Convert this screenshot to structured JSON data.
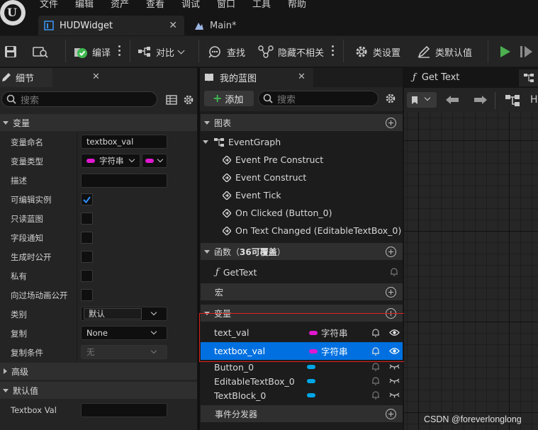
{
  "menu": [
    "文件",
    "编辑",
    "资产",
    "查看",
    "调试",
    "窗口",
    "工具",
    "帮助"
  ],
  "tabs": [
    {
      "label": "HUDWidget",
      "active": true
    },
    {
      "label": "Main*",
      "active": false
    }
  ],
  "toolbar": {
    "compile_label": "编译",
    "diff_label": "对比",
    "find_label": "查找",
    "hide_unrelated_label": "隐藏不相关",
    "class_settings_label": "类设置",
    "class_defaults_label": "类默认值"
  },
  "details": {
    "tab_label": "细节",
    "search_placeholder": "搜索",
    "section_variable": "变量",
    "rows": {
      "var_name_label": "变量命名",
      "var_name_value": "textbox_val",
      "var_type_label": "变量类型",
      "var_type_value": "字符串",
      "description_label": "描述",
      "instance_editable_label": "可编辑实例",
      "readonly_bp_label": "只读蓝图",
      "field_notify_label": "字段通知",
      "expose_on_spawn_label": "生成时公开",
      "private_label": "私有",
      "expose_cinematics_label": "向过场动画公开",
      "category_label": "类别",
      "category_value": "默认",
      "replication_label": "复制",
      "replication_value": "None",
      "replication_condition_label": "复制条件",
      "replication_condition_value": "无"
    },
    "section_advanced": "高级",
    "section_default": "默认值",
    "default_textbox_label": "Textbox Val"
  },
  "my_blueprint": {
    "tab_label": "我的蓝图",
    "add_label": "添加",
    "search_placeholder": "搜索",
    "graphs_label": "图表",
    "event_graph_label": "EventGraph",
    "events": [
      "Event Pre Construct",
      "Event Construct",
      "Event Tick",
      "On Clicked (Button_0)",
      "On Text Changed (EditableTextBox_0)"
    ],
    "functions_label": "函数（",
    "functions_count": "36可覆盖",
    "functions_close": "）",
    "function_get_text": "GetText",
    "macros_label": "宏",
    "variables_label": "变量",
    "variables": [
      {
        "name": "text_val",
        "type": "字符串",
        "color": "#e018d0"
      },
      {
        "name": "textbox_val",
        "type": "字符串",
        "color": "#e018d0"
      },
      {
        "name": "Button_0",
        "type": "",
        "color": "#00a6e6"
      },
      {
        "name": "EditableTextBox_0",
        "type": "",
        "color": "#00a6e6"
      },
      {
        "name": "TextBlock_0",
        "type": "",
        "color": "#00a6e6"
      }
    ],
    "event_dispatchers_label": "事件分发器"
  },
  "graph_tab_label": "Get Text",
  "graph_toolbar_letter": "H",
  "watermark": "CSDN @foreverlonglong",
  "colors": {
    "accent_selected": "#0070e0",
    "string_pin": "#e018d0",
    "object_pin": "#00a6e6",
    "compile_ok": "#3fb950",
    "play": "#4caf50",
    "highlight_box": "#e02020"
  }
}
